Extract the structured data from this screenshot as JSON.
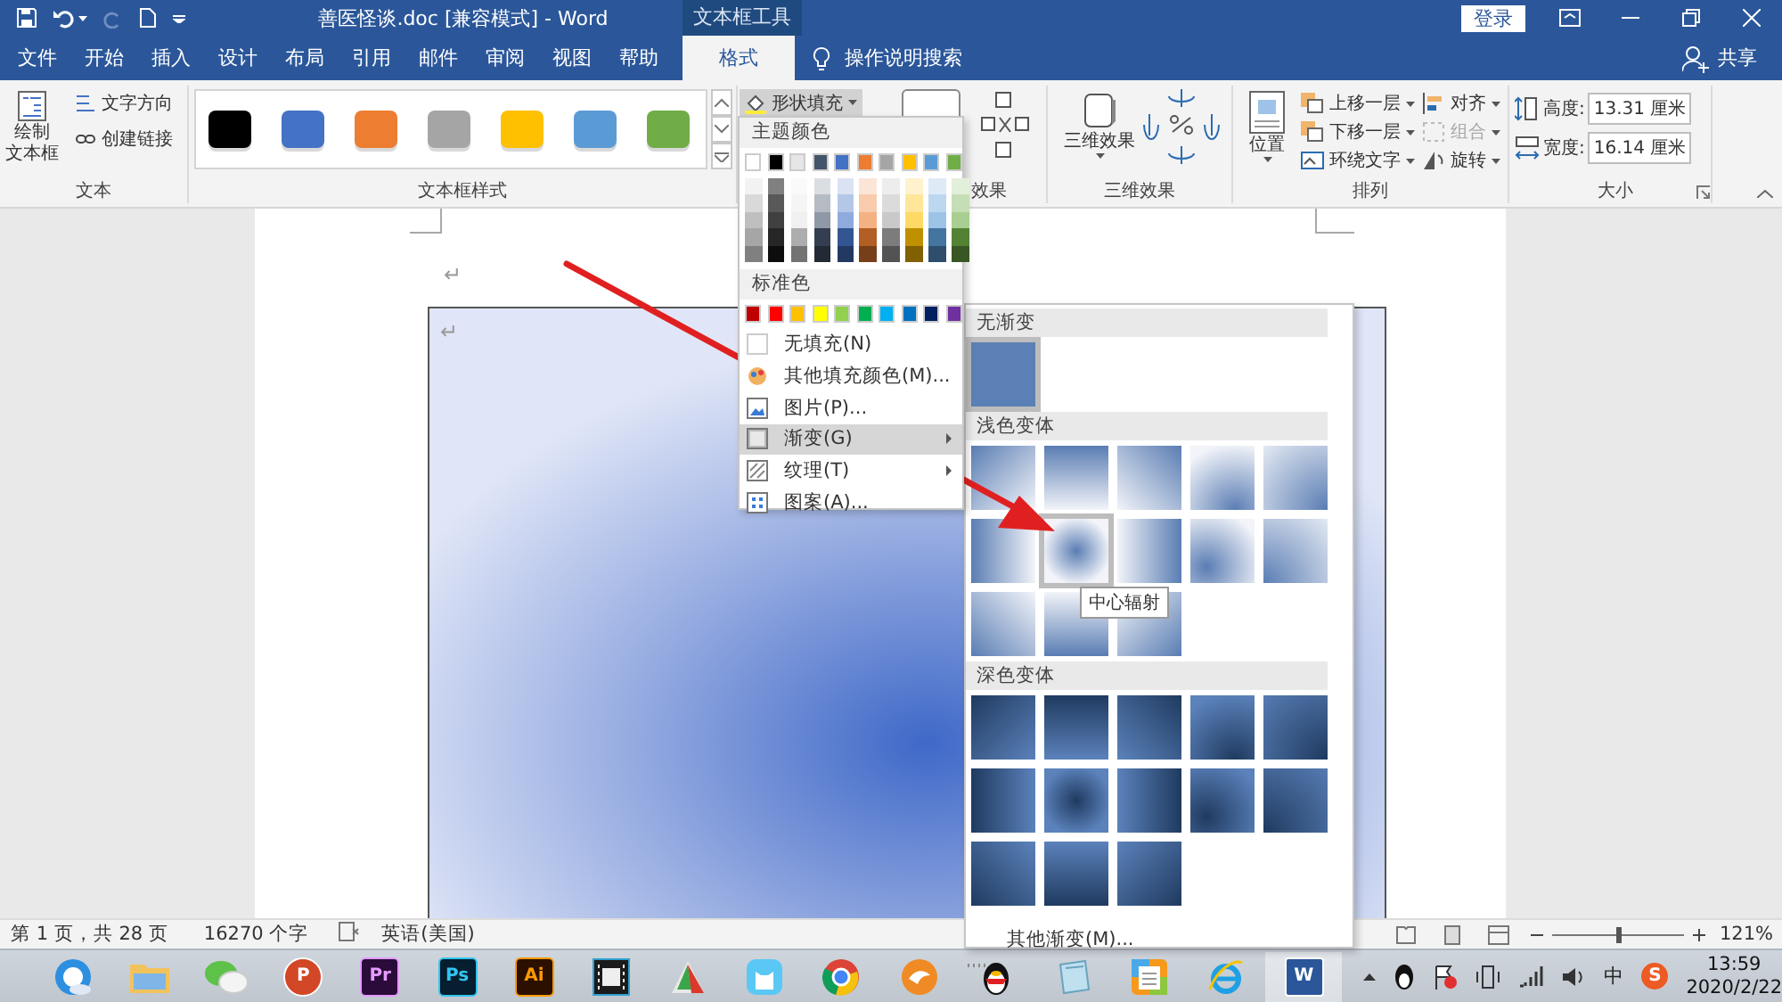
{
  "title_bar": {
    "title": "善医怪谈.doc [兼容模式] - Word",
    "context_tab": "文本框工具",
    "login": "登录"
  },
  "tabs": [
    {
      "label": "文件",
      "selected": false
    },
    {
      "label": "开始",
      "selected": false
    },
    {
      "label": "插入",
      "selected": false
    },
    {
      "label": "设计",
      "selected": false
    },
    {
      "label": "布局",
      "selected": false
    },
    {
      "label": "引用",
      "selected": false
    },
    {
      "label": "邮件",
      "selected": false
    },
    {
      "label": "审阅",
      "selected": false
    },
    {
      "label": "视图",
      "selected": false
    },
    {
      "label": "帮助",
      "selected": false
    },
    {
      "label": "格式",
      "selected": true
    }
  ],
  "tell_me": "操作说明搜索",
  "share": "共享",
  "ribbon": {
    "groups": [
      {
        "kind": "text",
        "label": "文本",
        "draw_button": [
          "绘制",
          "文本框"
        ],
        "buttons": [
          "文字方向",
          "创建链接"
        ]
      },
      {
        "kind": "styles",
        "label": "文本框样式",
        "swatches": [
          {
            "color": "#000000"
          },
          {
            "color": "#4472c4"
          },
          {
            "color": "#ed7d31"
          },
          {
            "color": "#a5a5a5"
          },
          {
            "color": "#ffc000"
          },
          {
            "color": "#5b9bd5"
          },
          {
            "color": "#70ad47"
          }
        ]
      },
      {
        "kind": "shape",
        "label": "效果",
        "fill_button": {
          "label": "形状填充",
          "expanded": true
        }
      },
      {
        "kind": "effects3d",
        "label": "三维效果",
        "button": "三维效果"
      },
      {
        "kind": "arrange",
        "label": "排列",
        "position": "位置",
        "items": [
          {
            "label": "上移一层",
            "disabled": false
          },
          {
            "label": "下移一层",
            "disabled": false
          },
          {
            "label": "环绕文字",
            "disabled": false
          },
          {
            "label": "对齐",
            "disabled": false
          },
          {
            "label": "组合",
            "disabled": true
          },
          {
            "label": "旋转",
            "disabled": false
          }
        ]
      },
      {
        "kind": "size",
        "label": "大小",
        "fields": [
          {
            "label": "高度:",
            "value": "13.31 厘米"
          },
          {
            "label": "宽度:",
            "value": "16.14 厘米"
          }
        ]
      }
    ]
  },
  "document": {
    "paragraph_marks": [
      "↵",
      "↵"
    ]
  },
  "fill_menu": {
    "theme_title": "主题颜色",
    "theme_colors": [
      {
        "color": "#ffffff"
      },
      {
        "color": "#000000"
      },
      {
        "color": "#e7e6e6"
      },
      {
        "color": "#44546a"
      },
      {
        "color": "#4472c4"
      },
      {
        "color": "#ed7d31"
      },
      {
        "color": "#a5a5a5"
      },
      {
        "color": "#ffc000"
      },
      {
        "color": "#5b9bd5"
      },
      {
        "color": "#70ad47"
      }
    ],
    "standard_title": "标准色",
    "standard_colors": [
      {
        "color": "#c00000"
      },
      {
        "color": "#ff0000"
      },
      {
        "color": "#ffc000"
      },
      {
        "color": "#ffff00"
      },
      {
        "color": "#92d050"
      },
      {
        "color": "#00b050"
      },
      {
        "color": "#00b0f0"
      },
      {
        "color": "#0070c0"
      },
      {
        "color": "#002060"
      },
      {
        "color": "#7030a0"
      }
    ],
    "items": [
      {
        "label": "无填充(N)",
        "kind": "item",
        "selected": false
      },
      {
        "label": "其他填充颜色(M)...",
        "kind": "item",
        "selected": false
      },
      {
        "label": "图片(P)...",
        "kind": "item",
        "selected": false
      },
      {
        "label": "渐变(G)",
        "kind": "submenu",
        "selected": true
      },
      {
        "label": "纹理(T)",
        "kind": "submenu",
        "selected": false
      },
      {
        "label": "图案(A)...",
        "kind": "item",
        "selected": false
      }
    ]
  },
  "gradient_menu": {
    "sections": [
      {
        "kind": "none",
        "title": "无渐变",
        "swatches": [
          {
            "selected": true
          }
        ]
      },
      {
        "kind": "light",
        "title": "浅色变体",
        "swatches": [
          {
            "selected": false
          },
          {
            "selected": false
          },
          {
            "selected": false
          },
          {
            "selected": false
          },
          {
            "selected": false
          },
          {
            "selected": false
          },
          {
            "selected": true
          },
          {
            "selected": false
          },
          {
            "selected": false
          },
          {
            "selected": false
          },
          {
            "selected": false
          },
          {
            "selected": false
          },
          {
            "selected": false
          }
        ]
      },
      {
        "kind": "dark",
        "title": "深色变体",
        "swatches": [
          {
            "selected": false
          },
          {
            "selected": false
          },
          {
            "selected": false
          },
          {
            "selected": false
          },
          {
            "selected": false
          },
          {
            "selected": false
          },
          {
            "selected": false
          },
          {
            "selected": false
          },
          {
            "selected": false
          },
          {
            "selected": false
          },
          {
            "selected": false
          },
          {
            "selected": false
          },
          {
            "selected": false
          }
        ]
      }
    ],
    "tooltip": "中心辐射",
    "more": "其他渐变(M)..."
  },
  "status_bar": {
    "page": "第 1 页，共 28 页",
    "words": "16270 个字",
    "language": "英语(美国)",
    "zoom": {
      "level": 0.5,
      "reading": "121%"
    }
  },
  "taskbar": {
    "apps": [
      {
        "kind": "globe"
      },
      {
        "kind": "folder"
      },
      {
        "kind": "chat"
      },
      {
        "kind": "slides",
        "badge": "P"
      },
      {
        "kind": "video",
        "badge": "Pr"
      },
      {
        "kind": "photo",
        "badge": "Ps"
      },
      {
        "kind": "vector",
        "badge": "Ai"
      },
      {
        "kind": "film"
      },
      {
        "kind": "leaf"
      },
      {
        "kind": "cat"
      },
      {
        "kind": "browser"
      },
      {
        "kind": "fox"
      },
      {
        "kind": "penguin"
      },
      {
        "kind": "notepad"
      },
      {
        "kind": "calendar"
      },
      {
        "kind": "explorer"
      },
      {
        "kind": "word",
        "badge": "W"
      }
    ],
    "ime": "中",
    "ime_badge": "S",
    "time": "13:59",
    "date": "2020/2/22"
  }
}
